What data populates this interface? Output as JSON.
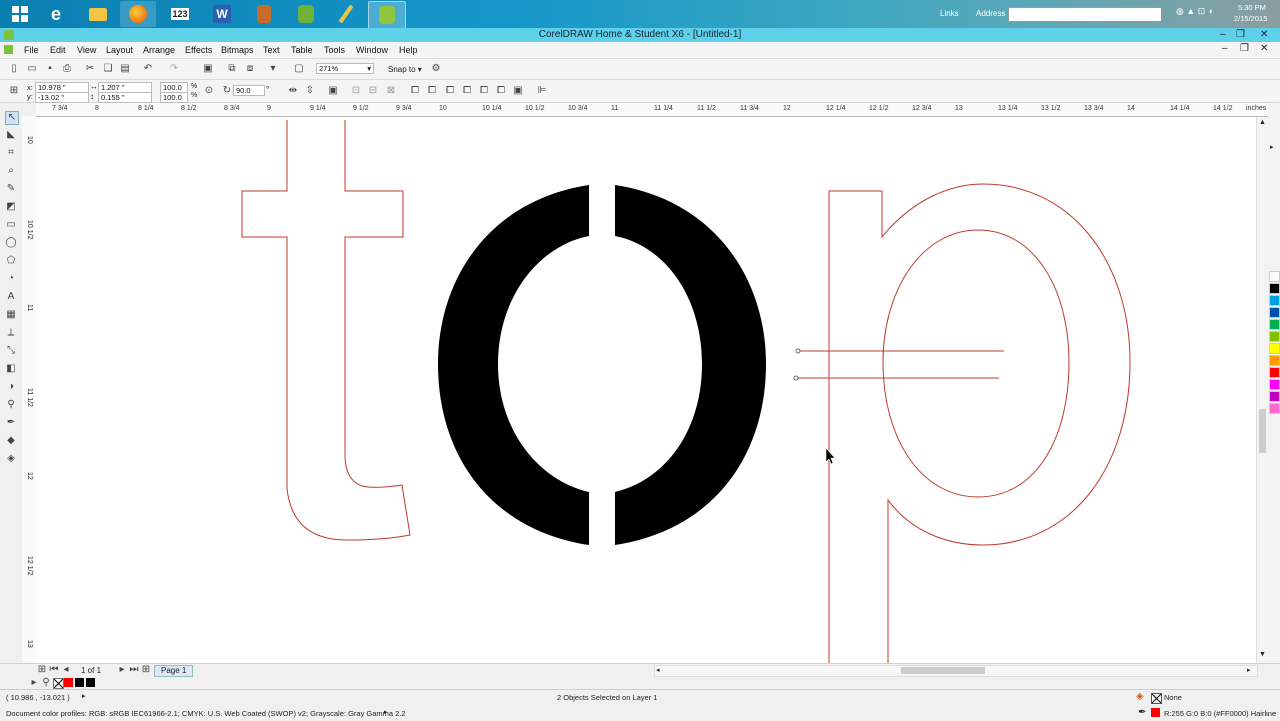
{
  "taskbar": {
    "apps": [
      "start-button",
      "internet-explorer",
      "file-explorer",
      "firefox",
      "calendar-app",
      "word",
      "app",
      "evernote",
      "pen-tool-app",
      "coreldraw"
    ],
    "calendar_label": "123",
    "links_label": "Links",
    "address_label": "Address",
    "address_value": "",
    "time": "5:30 PM",
    "date": "2/15/2015"
  },
  "window": {
    "title": "CorelDRAW Home & Student X6 - [Untitled-1]",
    "minimize": "–",
    "restore": "❐",
    "close": "✕"
  },
  "menu": [
    "File",
    "Edit",
    "View",
    "Layout",
    "Arrange",
    "Effects",
    "Bitmaps",
    "Text",
    "Table",
    "Tools",
    "Window",
    "Help"
  ],
  "toolbar": {
    "zoom": "271%",
    "snap_to": "Snap to"
  },
  "properties": {
    "x_label": "x:",
    "y_label": "y:",
    "x": "10.978 \"",
    "y": "-13.02 \"",
    "width": "1.207 \"",
    "height": "0.155 \"",
    "scale_x": "100.0",
    "scale_y": "100.0",
    "pct": "%",
    "rotation": "90.0",
    "deg": "°"
  },
  "ruler": {
    "top_labels": [
      "7 3/4",
      "8",
      "8 1/4",
      "8 1/2",
      "8 3/4",
      "9",
      "9 1/4",
      "9 1/2",
      "9 3/4",
      "10",
      "10 1/4",
      "10 1/2",
      "10 3/4",
      "11",
      "11 1/4",
      "11 1/2",
      "11 3/4",
      "12",
      "12 1/4",
      "12 1/2",
      "12 3/4",
      "13",
      "13 1/4",
      "13 1/2",
      "13 3/4",
      "14",
      "14 1/4",
      "14 1/2"
    ],
    "units": "inches",
    "left_labels": [
      "10",
      "10 1/2",
      "11",
      "11 1/2",
      "12",
      "12 1/2",
      "13"
    ]
  },
  "pages": {
    "counter": "1 of 1",
    "tab": "Page 1"
  },
  "status": {
    "coords": "( 10.986 , -13.021 )",
    "selection": "2 Objects Selected on Layer 1",
    "profiles": "Document color profiles: RGB: sRGB IEC61966-2.1; CMYK: U.S. Web Coated (SWOP) v2; Grayscale: Gray Gamma 2.2",
    "fill": "None",
    "outline": "R:255 G:0 B:0 (#FF0000)  Hairline"
  },
  "colors": {
    "outline": "#c0392b",
    "glyph": "#000000",
    "palette": [
      "#ffffff",
      "#000000",
      "#00a0e9",
      "#0050b3",
      "#00b050",
      "#7fc000",
      "#ffff00",
      "#ff9900",
      "#ff0000",
      "#ff00ff",
      "#c000c0",
      "#ff66cc"
    ]
  }
}
